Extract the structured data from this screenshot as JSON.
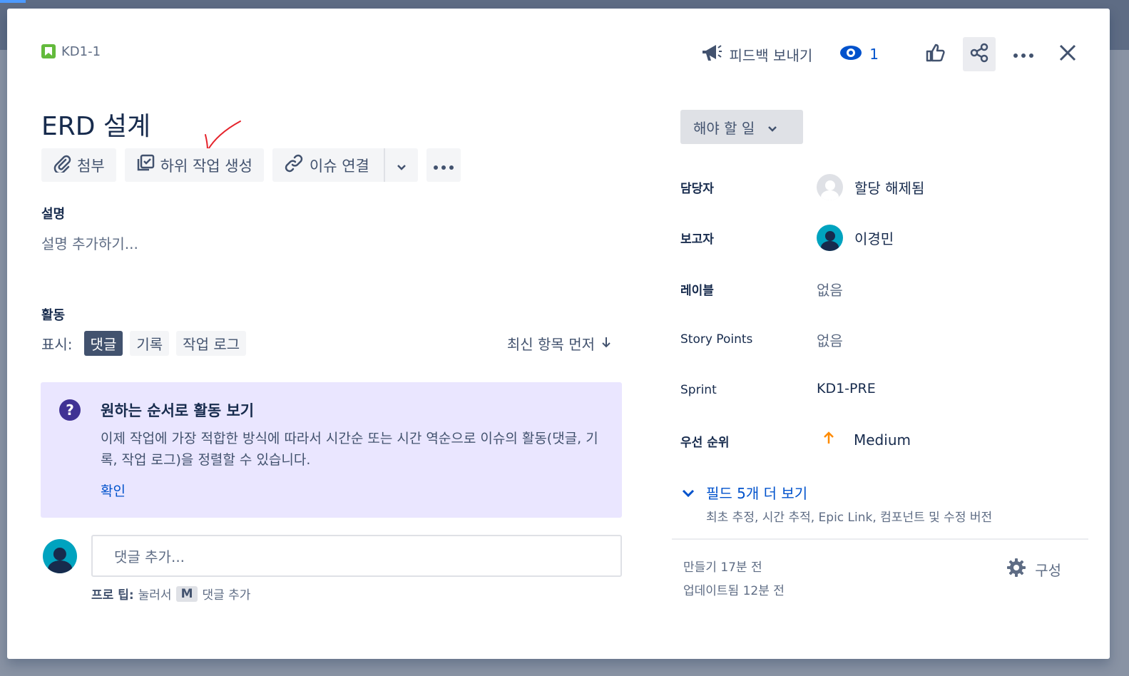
{
  "colors": {
    "accent": "#0052cc",
    "story": "#63ba3c",
    "info_bg": "#eae6ff",
    "priority_medium": "#ff8b00"
  },
  "header": {
    "issue_key": "KD1-1",
    "feedback_label": "피드백 보내기",
    "watch_count": "1",
    "icons": [
      "megaphone-icon",
      "eye-icon",
      "thumbs-up-icon",
      "share-icon",
      "more-icon",
      "close-icon"
    ]
  },
  "issue": {
    "title": "ERD 설계",
    "toolbar": {
      "attach": "첨부",
      "subtask": "하위 작업 생성",
      "link": "이슈 연결"
    },
    "description": {
      "label": "설명",
      "placeholder": "설명 추가하기..."
    }
  },
  "activity": {
    "label": "활동",
    "show_label": "표시:",
    "filters": [
      "댓글",
      "기록",
      "작업 로그"
    ],
    "selected_filter": "댓글",
    "sort_label": "최신 항목 먼저",
    "info": {
      "title": "원하는 순서로 활동 보기",
      "body": "이제 작업에 가장 적합한 방식에 따라서 시간순 또는 시간 역순으로 이슈의 활동(댓글, 기록, 작업 로그)을 정렬할 수 있습니다.",
      "confirm": "확인"
    },
    "comment_placeholder": "댓글 추가...",
    "tip_prefix": "프로 팁:",
    "tip_press": "눌러서",
    "tip_key": "M",
    "tip_suffix": "댓글 추가"
  },
  "sidebar": {
    "status": "해야 할 일",
    "fields": {
      "assignee_label": "담당자",
      "assignee_value": "할당 해제됨",
      "reporter_label": "보고자",
      "reporter_value": "이경민",
      "labels_label": "레이블",
      "labels_value": "없음",
      "points_label": "Story Points",
      "points_value": "없음",
      "sprint_label": "Sprint",
      "sprint_value": "KD1-PRE",
      "priority_label": "우선 순위",
      "priority_value": "Medium"
    },
    "more_fields_link": "필드 5개 더 보기",
    "more_fields_sub": "최초 추정, 시간 추적, Epic Link, 컴포넌트 및 수정 버전",
    "created": "만들기 17분 전",
    "updated": "업데이트됨 12분 전",
    "configure": "구성"
  }
}
